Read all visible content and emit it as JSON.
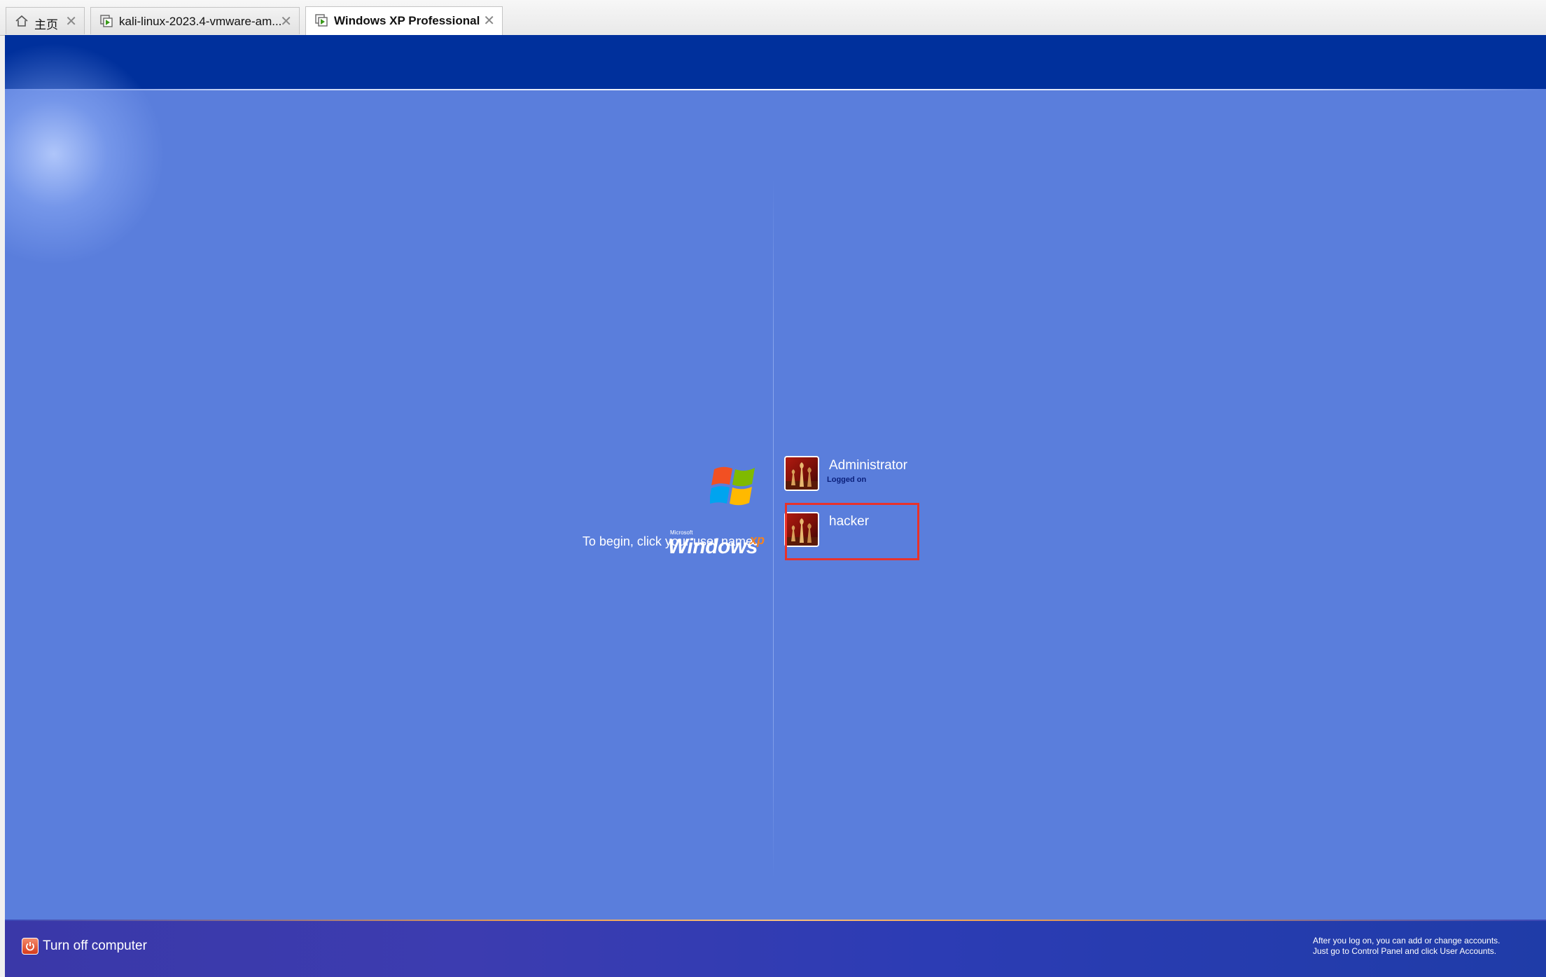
{
  "tabs": [
    {
      "label": "主页",
      "icon": "home-icon",
      "active": false
    },
    {
      "label": "kali-linux-2023.4-vmware-am...",
      "icon": "vm-icon",
      "active": false
    },
    {
      "label": "Windows XP Professional",
      "icon": "vm-icon",
      "active": true
    }
  ],
  "logon": {
    "logo_small_text": "Microsoft",
    "logo_wordmark": "Windows",
    "logo_version": "xp",
    "prompt": "To begin, click your user name",
    "users": [
      {
        "name": "Administrator",
        "status": "Logged on"
      },
      {
        "name": "hacker",
        "status": ""
      }
    ],
    "turn_off_label": "Turn off computer",
    "help_line1": "After you log on, you can add or change accounts.",
    "help_line2": "Just go to Control Panel and click User Accounts."
  },
  "colors": {
    "background": "#5a7edc",
    "top_bar": "#00309c",
    "highlight_box": "#e8322a"
  }
}
